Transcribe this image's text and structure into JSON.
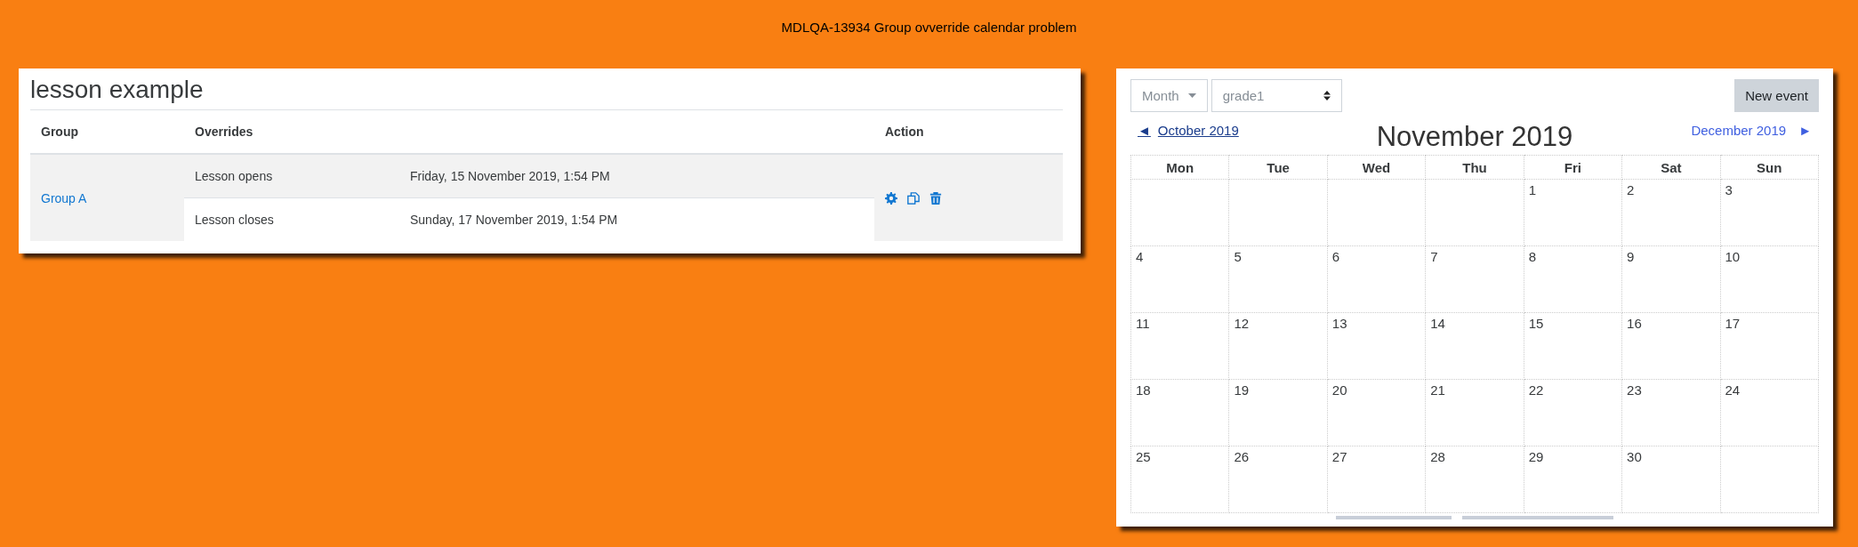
{
  "page_title": "MDLQA-13934 Group ovverride calendar problem",
  "overrides_card": {
    "title": "lesson example",
    "columns": [
      "Group",
      "Overrides",
      "Action"
    ],
    "groups": [
      {
        "name": "Group A",
        "overrides": [
          {
            "label": "Lesson opens",
            "date": "Friday, 15 November 2019, 1:54 PM"
          },
          {
            "label": "Lesson closes",
            "date": "Sunday, 17 November 2019, 1:54 PM"
          }
        ]
      }
    ]
  },
  "calendar": {
    "view_menu": "Month",
    "course_select": "grade1",
    "new_event_button": "New event",
    "prev": {
      "arrow": "◄",
      "label": "October 2019"
    },
    "month_title": "November 2019",
    "next": {
      "label": "December 2019",
      "arrow": "►"
    },
    "weekdays": [
      "Mon",
      "Tue",
      "Wed",
      "Thu",
      "Fri",
      "Sat",
      "Sun"
    ],
    "weeks": [
      {
        "cells": [
          {
            "kind": "blank"
          },
          {
            "kind": "blank"
          },
          {
            "kind": "blank"
          },
          {
            "kind": "blank"
          },
          {
            "kind": "day",
            "day": "1"
          },
          {
            "kind": "day",
            "day": "2"
          },
          {
            "kind": "day",
            "day": "3"
          }
        ]
      },
      {
        "cells": [
          {
            "kind": "day",
            "day": "4"
          },
          {
            "kind": "day",
            "day": "5"
          },
          {
            "kind": "day",
            "day": "6"
          },
          {
            "kind": "day",
            "day": "7"
          },
          {
            "kind": "day",
            "day": "8"
          },
          {
            "kind": "day",
            "day": "9"
          },
          {
            "kind": "day",
            "day": "10"
          }
        ]
      },
      {
        "cells": [
          {
            "kind": "day",
            "day": "11"
          },
          {
            "kind": "day",
            "day": "12"
          },
          {
            "kind": "day",
            "day": "13"
          },
          {
            "kind": "day",
            "day": "14"
          },
          {
            "kind": "day",
            "day": "15"
          },
          {
            "kind": "day",
            "day": "16"
          },
          {
            "kind": "day",
            "day": "17"
          }
        ]
      },
      {
        "cells": [
          {
            "kind": "day",
            "day": "18"
          },
          {
            "kind": "day",
            "day": "19"
          },
          {
            "kind": "day",
            "day": "20"
          },
          {
            "kind": "day",
            "day": "21"
          },
          {
            "kind": "day",
            "day": "22"
          },
          {
            "kind": "day",
            "day": "23"
          },
          {
            "kind": "day",
            "day": "24"
          }
        ]
      },
      {
        "cells": [
          {
            "kind": "day",
            "day": "25"
          },
          {
            "kind": "day",
            "day": "26"
          },
          {
            "kind": "day",
            "day": "27"
          },
          {
            "kind": "day",
            "day": "28"
          },
          {
            "kind": "day",
            "day": "29"
          },
          {
            "kind": "day",
            "day": "30"
          },
          {
            "kind": "blank"
          }
        ]
      }
    ]
  }
}
